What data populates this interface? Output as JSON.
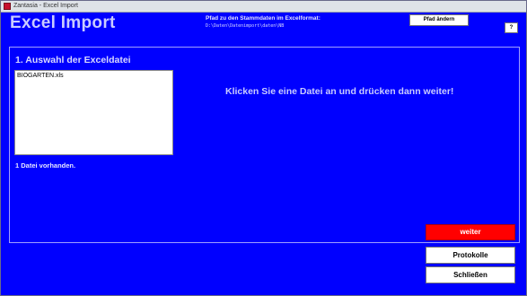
{
  "window": {
    "title": "Zantasia - Excel Import"
  },
  "header": {
    "app_title": "Excel Import",
    "path_label": "Pfad zu den Stammdaten im Excelformat:",
    "path_value": "D:\\Daten\\Datenimport\\daten\\NB",
    "change_path_button": "Pfad ändern",
    "help_button": "?"
  },
  "section": {
    "title": "1. Auswahl der Exceldatei",
    "files": [
      "BIOGARTEN.xls"
    ],
    "file_count_text": "1 Datei vorhanden.",
    "instruction": "Klicken Sie eine Datei an und drücken dann weiter!"
  },
  "buttons": {
    "next": "weiter",
    "logs": "Protokolle",
    "close": "Schließen"
  },
  "colors": {
    "background": "#0000ff",
    "accent_next": "#ff0000"
  }
}
